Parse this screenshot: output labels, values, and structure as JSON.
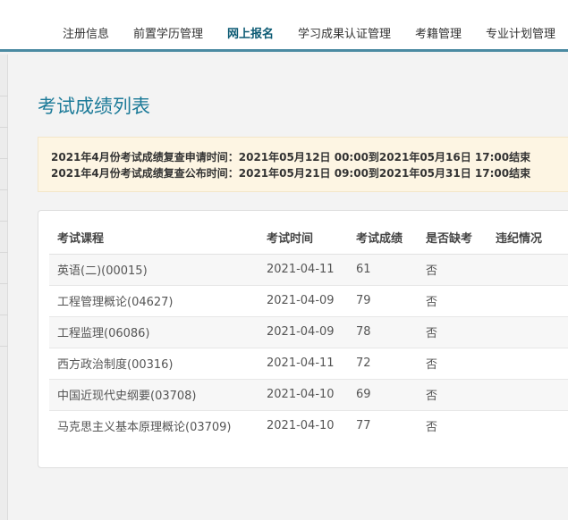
{
  "nav": {
    "items": [
      {
        "label": "注册信息"
      },
      {
        "label": "前置学历管理"
      },
      {
        "label": "网上报名"
      },
      {
        "label": "学习成果认证管理"
      },
      {
        "label": "考籍管理"
      },
      {
        "label": "专业计划管理"
      }
    ],
    "active_index": 2
  },
  "page": {
    "title": "考试成绩列表"
  },
  "notice": {
    "lines": [
      "2021年4月份考试成绩复查申请时间：2021年05月12日 00:00到2021年05月16日 17:00结束",
      "2021年4月份考试成绩复查公布时间：2021年05月21日 09:00到2021年05月31日 17:00结束"
    ]
  },
  "table": {
    "headers": [
      "考试课程",
      "考试时间",
      "考试成绩",
      "是否缺考",
      "违纪情况"
    ],
    "rows": [
      {
        "course": "英语(二)(00015)",
        "date": "2021-04-11",
        "score": "61",
        "absent": "否",
        "violation": ""
      },
      {
        "course": "工程管理概论(04627)",
        "date": "2021-04-09",
        "score": "79",
        "absent": "否",
        "violation": ""
      },
      {
        "course": "工程监理(06086)",
        "date": "2021-04-09",
        "score": "78",
        "absent": "否",
        "violation": ""
      },
      {
        "course": "西方政治制度(00316)",
        "date": "2021-04-11",
        "score": "72",
        "absent": "否",
        "violation": ""
      },
      {
        "course": "中国近现代史纲要(03708)",
        "date": "2021-04-10",
        "score": "69",
        "absent": "否",
        "violation": ""
      },
      {
        "course": "马克思主义基本原理概论(03709)",
        "date": "2021-04-10",
        "score": "77",
        "absent": "否",
        "violation": ""
      }
    ]
  },
  "colors": {
    "accent": "#1b7a98",
    "nav_border": "#4a8aa2",
    "notice_bg": "#fdf5e3"
  }
}
